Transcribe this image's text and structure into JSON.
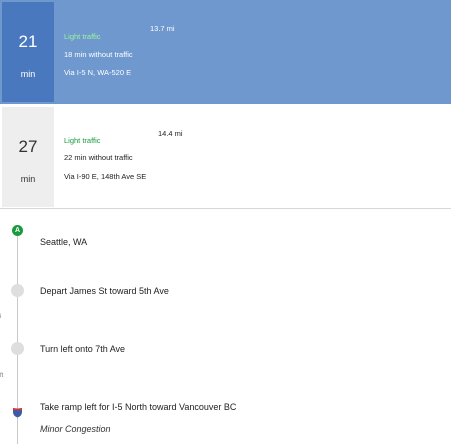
{
  "routes": [
    {
      "time": "21",
      "unit": "min",
      "traffic": "Light traffic",
      "without_traffic": "18 min without traffic",
      "via": "Via I-5 N, WA-520 E",
      "distance": "13.7 mi",
      "selected": true
    },
    {
      "time": "27",
      "unit": "min",
      "traffic": "Light traffic",
      "without_traffic": "22 min without traffic",
      "via": "Via I-90 E, 148th Ave SE",
      "distance": "14.4 mi",
      "selected": false
    }
  ],
  "origin": {
    "marker": "A",
    "label": "Seattle, WA"
  },
  "steps": [
    {
      "icon": "circle-icon",
      "text": "Depart James St toward 5th Ave"
    },
    {
      "icon": "circle-icon",
      "text": "Turn left onto 7th Ave"
    },
    {
      "icon": "interstate-shield-icon",
      "text": "Take ramp left for I-5 North toward Vancouver BC",
      "note": "Minor Congestion"
    }
  ],
  "edge_marks": [
    "i",
    "ft"
  ],
  "colors": {
    "selected_bg": "#6f98cf",
    "selected_time_bg": "#4a78be",
    "light_traffic_selected": "#9cf59c",
    "light_traffic": "#169b3a",
    "origin_pin": "#1a9a3f"
  }
}
